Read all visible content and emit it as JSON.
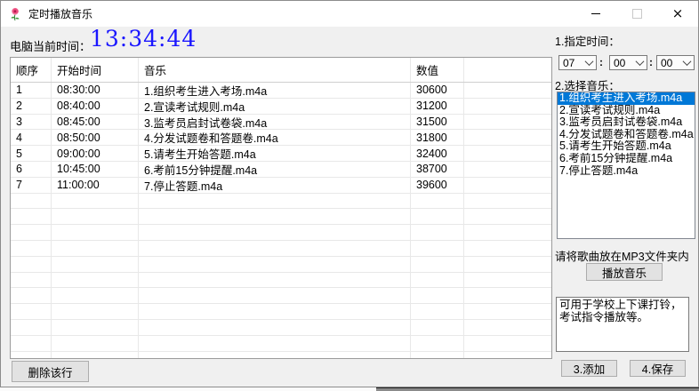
{
  "window": {
    "title": "定时播放音乐",
    "app_icon": "rose-icon",
    "controls": {
      "minimize": "minimize-icon",
      "maximize": "maximize-icon",
      "close": "×"
    }
  },
  "clock": {
    "label": "电脑当前时间：",
    "time": "13:34:44"
  },
  "table": {
    "headers": [
      "顺序",
      "开始时间",
      "音乐",
      "数值"
    ],
    "rows": [
      [
        "1",
        "08:30:00",
        "1.组织考生进入考场.m4a",
        "30600"
      ],
      [
        "2",
        "08:40:00",
        "2.宣读考试规则.m4a",
        "31200"
      ],
      [
        "3",
        "08:45:00",
        "3.监考员启封试卷袋.m4a",
        "31500"
      ],
      [
        "4",
        "08:50:00",
        "4.分发试题卷和答题卷.m4a",
        "31800"
      ],
      [
        "5",
        "09:00:00",
        "5.请考生开始答题.m4a",
        "32400"
      ],
      [
        "6",
        "10:45:00",
        "6.考前15分钟提醒.m4a",
        "38700"
      ],
      [
        "7",
        "11:00:00",
        "7.停止答题.m4a",
        "39600"
      ]
    ]
  },
  "actions": {
    "delete_row": "删除该行"
  },
  "panel": {
    "step1_label": "1.指定时间：",
    "hour": "07",
    "minute": "00",
    "second": "00",
    "time_separator": ":",
    "step2_label": "2.选择音乐：",
    "music_list": [
      "1.组织考生进入考场.m4a",
      "2.宣读考试规则.m4a",
      "3.监考员启封试卷袋.m4a",
      "4.分发试题卷和答题卷.m4a",
      "5.请考生开始答题.m4a",
      "6.考前15分钟提醒.m4a",
      "7.停止答题.m4a"
    ],
    "selected_index": 0,
    "mp3_hint": "请将歌曲放在MP3文件夹内",
    "play_button": "播放音乐",
    "note": "可用于学校上下课打铃，考试指令播放等。",
    "add_button": "3.添加",
    "save_button": "4.保存"
  },
  "colors": {
    "time_text": "#1a16ff",
    "selection_bg": "#0078d7",
    "titlebar_bg": "#ffffff",
    "client_bg": "#f0f0f0"
  }
}
